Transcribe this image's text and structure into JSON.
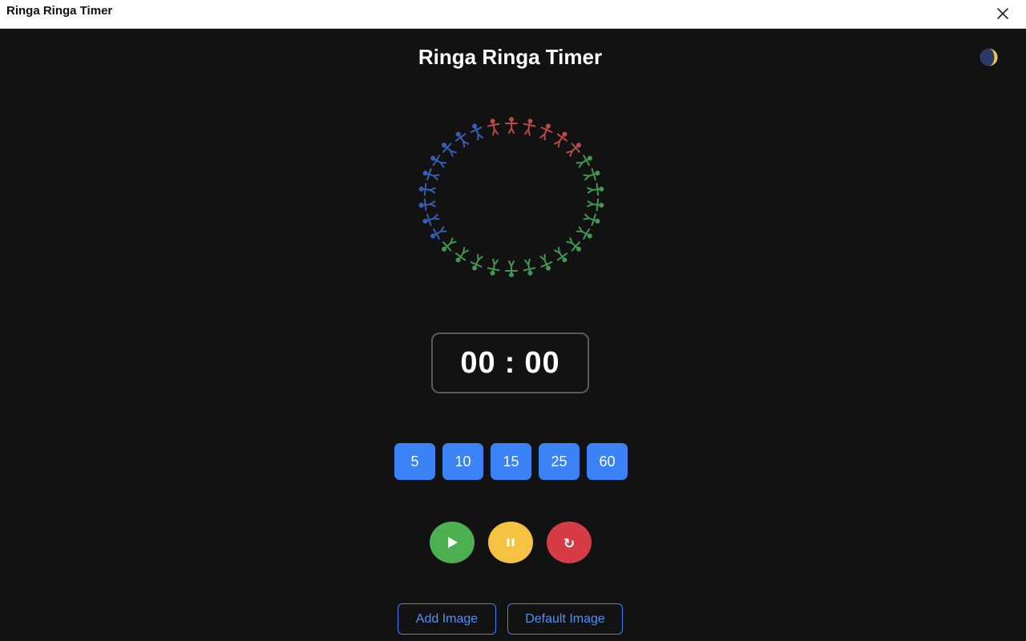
{
  "window": {
    "title": "Ringa Ringa Timer",
    "close_icon": "close-icon"
  },
  "app": {
    "title": "Ringa Ringa Timer",
    "theme_icon": "moon-sun-icon"
  },
  "ring": {
    "description_icon": "ring-of-people-icon",
    "colors": [
      "#d9534f",
      "#4cae5f",
      "#3b6fd4"
    ]
  },
  "timer": {
    "minutes": "00",
    "separator": ":",
    "seconds": "00"
  },
  "presets": [
    "5",
    "10",
    "15",
    "25",
    "60"
  ],
  "controls": {
    "play_icon": "play-icon",
    "pause_icon": "pause-icon",
    "reset_icon": "reset-icon",
    "reset_glyph": "↻"
  },
  "image_buttons": {
    "add_label": "Add Image",
    "default_label": "Default Image"
  },
  "colors": {
    "background": "#121212",
    "accent": "#3b82f6",
    "play": "#4caf50",
    "pause": "#f5c242",
    "reset": "#d63c45"
  }
}
